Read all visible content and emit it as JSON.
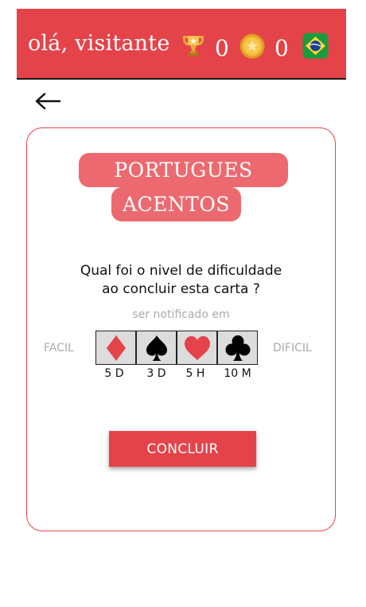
{
  "header": {
    "greeting": "olá, visitante",
    "trophy_count": "0",
    "coin_count": "0",
    "icons": {
      "trophy": "trophy-icon",
      "coin": "coin-icon",
      "flag": "brazil-flag-icon"
    }
  },
  "nav": {
    "back_icon": "arrow-left-icon"
  },
  "card": {
    "title_line1": "PORTUGUES",
    "title_line2": "ACENTOS",
    "question_line1": "Qual foi o nivel de dificuldade",
    "question_line2": "ao concluir esta carta ?",
    "notify_label": "ser notificado em",
    "easy_label": "FACIL",
    "hard_label": "DIFICIL",
    "options": [
      {
        "suit": "diamond",
        "color": "#e5434a",
        "interval": "5 D"
      },
      {
        "suit": "spade",
        "color": "#000000",
        "interval": "3 D"
      },
      {
        "suit": "heart",
        "color": "#e5434a",
        "interval": "5 H"
      },
      {
        "suit": "club",
        "color": "#000000",
        "interval": "10 M"
      }
    ],
    "conclude_label": "CONCLUIR"
  },
  "colors": {
    "accent": "#e5434a",
    "pill": "#ec6a6f",
    "muted": "#aaaaaa",
    "option_bg": "#dcdcdc"
  }
}
